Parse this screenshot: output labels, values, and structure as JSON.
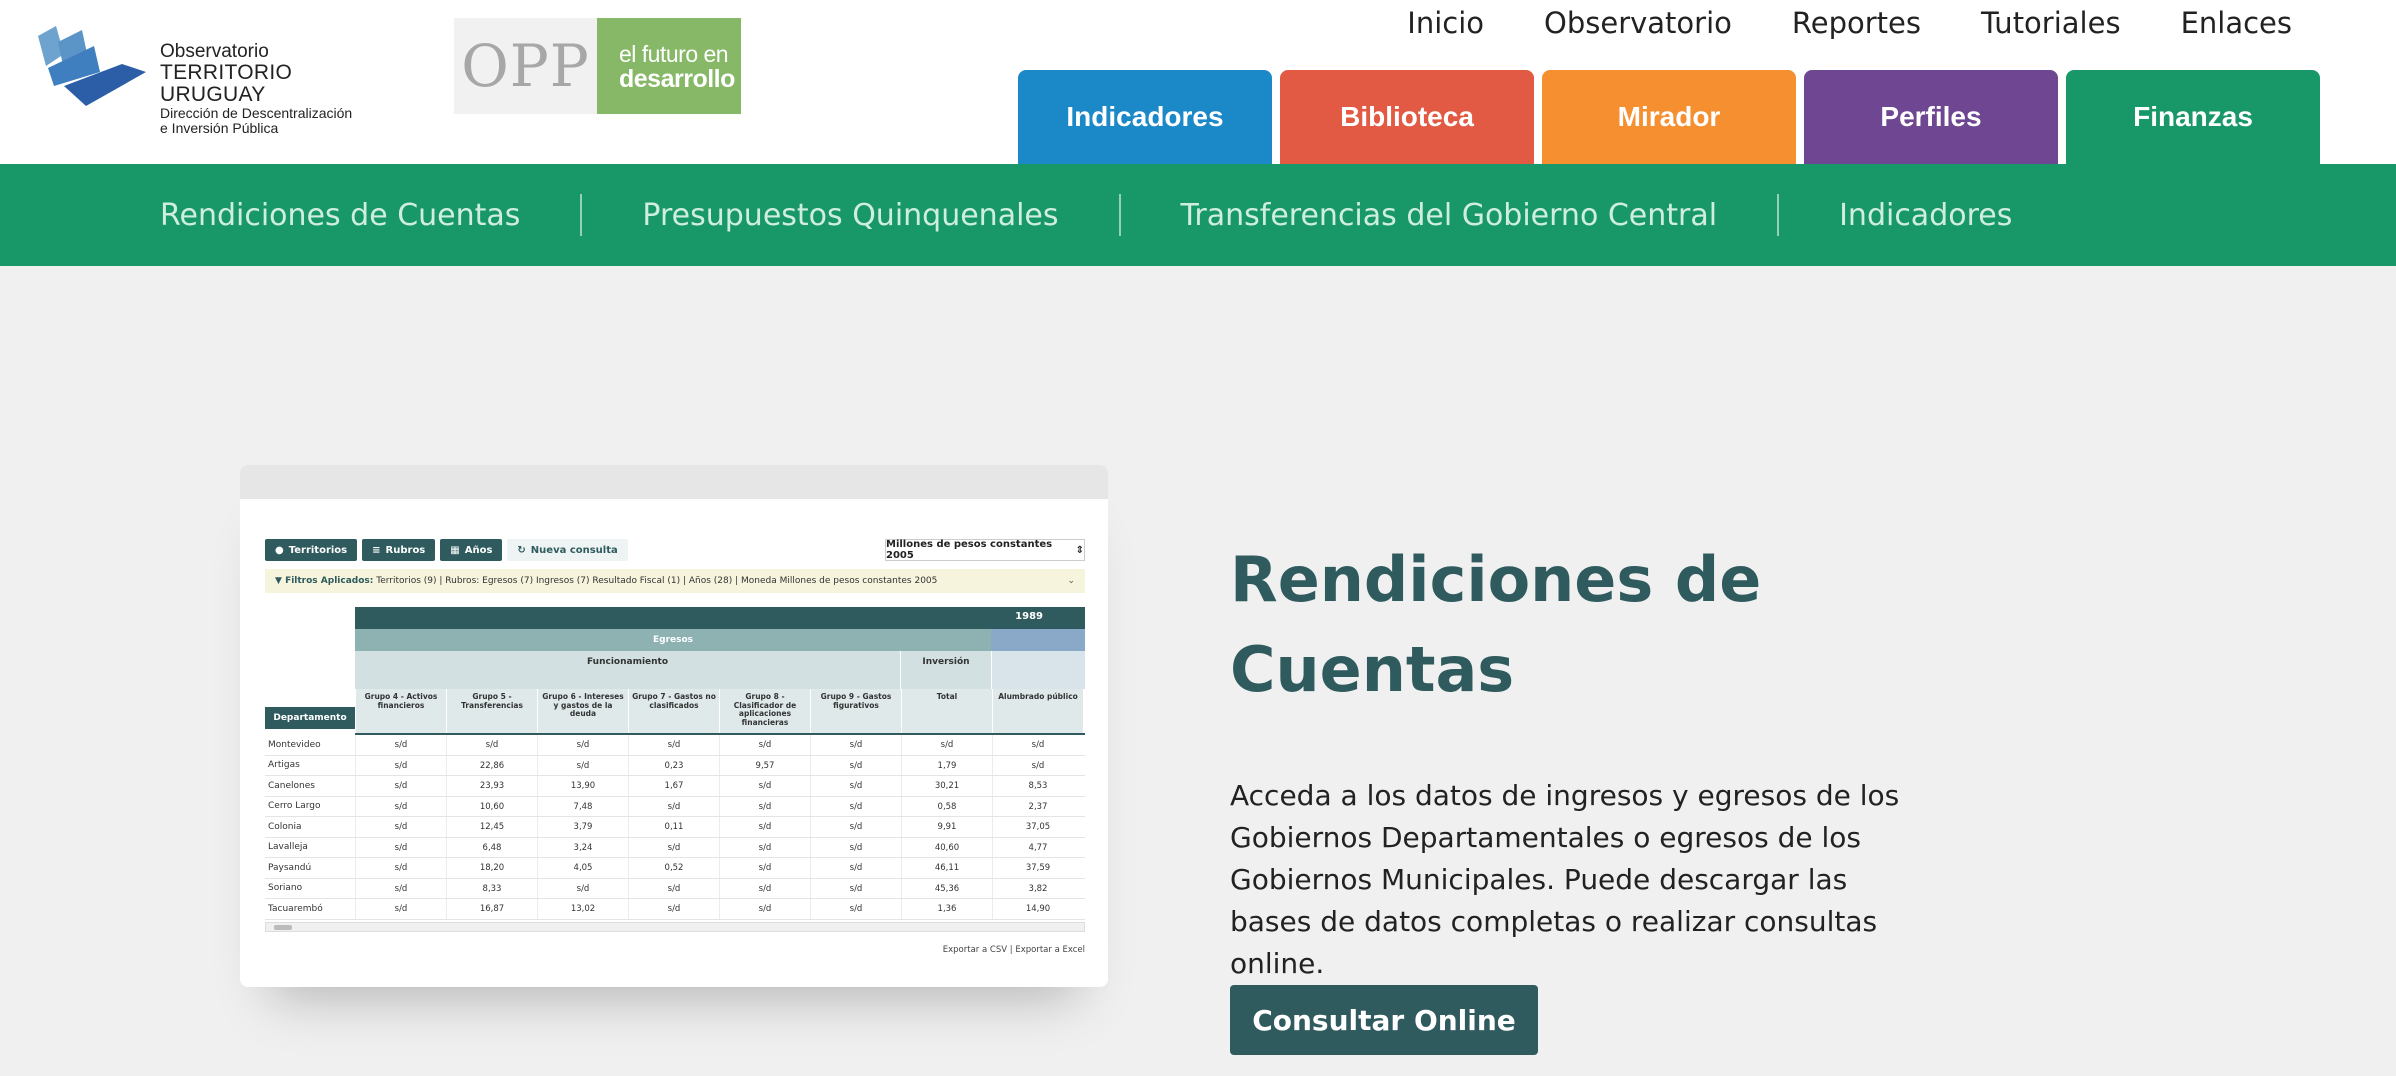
{
  "logo": {
    "line1": "Observatorio",
    "line2": "TERRITORIO URUGUAY",
    "line3": "Dirección de Descentralización",
    "line4": "e Inversión Pública"
  },
  "partners": {
    "opp": "OPP",
    "futuro_line1": "el futuro en",
    "futuro_line2": "desarrollo"
  },
  "top_nav": [
    "Inicio",
    "Observatorio",
    "Reportes",
    "Tutoriales",
    "Enlaces"
  ],
  "tabs": [
    {
      "label": "Indicadores",
      "color": "#1b88c8"
    },
    {
      "label": "Biblioteca",
      "color": "#e25a43"
    },
    {
      "label": "Mirador",
      "color": "#f68f30"
    },
    {
      "label": "Perfiles",
      "color": "#6f4691"
    },
    {
      "label": "Finanzas",
      "color": "#189868"
    }
  ],
  "sub_nav": [
    "Rendiciones de Cuentas",
    "Presupuestos Quinquenales",
    "Transferencias del Gobierno Central",
    "Indicadores"
  ],
  "preview": {
    "btn_territorios": "Territorios",
    "btn_rubros": "Rubros",
    "btn_anos": "Años",
    "btn_nueva": "Nueva consulta",
    "select_value": "Millones de pesos constantes 2005",
    "filter_label": "Filtros Aplicados:",
    "filter_text": "Territorios (9) | Rubros: Egresos (7) Ingresos (7) Resultado Fiscal (1) | Años (28) | Moneda Millones de pesos constantes 2005",
    "year": "1989",
    "egresos": "Egresos",
    "funcionamiento": "Funcionamiento",
    "inversion": "Inversión",
    "departamento": "Departamento",
    "columns": [
      "Grupo 4 - Activos financieros",
      "Grupo 5 - Transferencias",
      "Grupo 6 - Intereses y gastos de la deuda",
      "Grupo 7 - Gastos no clasificados",
      "Grupo 8 - Clasificador de aplicaciones financieras",
      "Grupo 9 - Gastos figurativos",
      "Total",
      "Alumbrado público"
    ],
    "rows": [
      {
        "dep": "Montevideo",
        "vals": [
          "s/d",
          "s/d",
          "s/d",
          "s/d",
          "s/d",
          "s/d",
          "s/d",
          "s/d"
        ]
      },
      {
        "dep": "Artigas",
        "vals": [
          "s/d",
          "22,86",
          "s/d",
          "0,23",
          "9,57",
          "s/d",
          "1,79",
          "s/d"
        ]
      },
      {
        "dep": "Canelones",
        "vals": [
          "s/d",
          "23,93",
          "13,90",
          "1,67",
          "s/d",
          "s/d",
          "30,21",
          "8,53"
        ]
      },
      {
        "dep": "Cerro Largo",
        "vals": [
          "s/d",
          "10,60",
          "7,48",
          "s/d",
          "s/d",
          "s/d",
          "0,58",
          "2,37"
        ]
      },
      {
        "dep": "Colonia",
        "vals": [
          "s/d",
          "12,45",
          "3,79",
          "0,11",
          "s/d",
          "s/d",
          "9,91",
          "37,05"
        ]
      },
      {
        "dep": "Lavalleja",
        "vals": [
          "s/d",
          "6,48",
          "3,24",
          "s/d",
          "s/d",
          "s/d",
          "40,60",
          "4,77"
        ]
      },
      {
        "dep": "Paysandú",
        "vals": [
          "s/d",
          "18,20",
          "4,05",
          "0,52",
          "s/d",
          "s/d",
          "46,11",
          "37,59"
        ]
      },
      {
        "dep": "Soriano",
        "vals": [
          "s/d",
          "8,33",
          "s/d",
          "s/d",
          "s/d",
          "s/d",
          "45,36",
          "3,82"
        ]
      },
      {
        "dep": "Tacuarembó",
        "vals": [
          "s/d",
          "16,87",
          "13,02",
          "s/d",
          "s/d",
          "s/d",
          "1,36",
          "14,90"
        ]
      }
    ],
    "export_csv": "Exportar a CSV",
    "export_excel": "Exportar a Excel"
  },
  "content": {
    "title_line1": "Rendiciones de",
    "title_line2": "Cuentas",
    "description": "Acceda a los datos de ingresos y egresos de los Gobiernos Departamentales o egresos de los Gobiernos Municipales. Puede descargar las bases de datos completas o realizar consultas online.",
    "cta_label": "Consultar Online"
  }
}
